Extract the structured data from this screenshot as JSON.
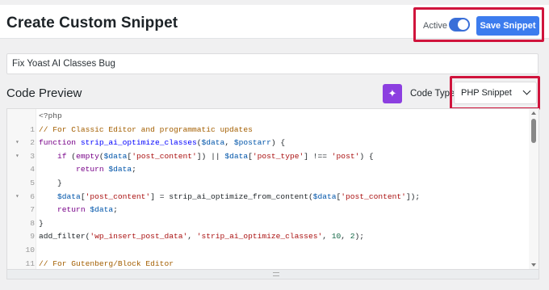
{
  "header": {
    "title": "Create Custom Snippet",
    "active_label": "Active",
    "active_on": true,
    "save_label": "Save Snippet"
  },
  "snippet": {
    "title_value": "Fix Yoast AI Classes Bug"
  },
  "code_section": {
    "title": "Code Preview",
    "code_type_label": "Code Type",
    "code_type_value": "PHP Snippet"
  },
  "colors": {
    "accent": "#3c7cee",
    "ai_button": "#8c3fe0",
    "highlight": "#d0143c"
  },
  "code_lines": [
    {
      "num": "",
      "fold": false,
      "tokens": [
        {
          "t": "<?php",
          "c": "meta"
        }
      ]
    },
    {
      "num": "1",
      "fold": false,
      "tokens": [
        {
          "t": "// For Classic Editor and programmatic updates",
          "c": "comment"
        }
      ]
    },
    {
      "num": "2",
      "fold": true,
      "tokens": [
        {
          "t": "function ",
          "c": "keyword"
        },
        {
          "t": "strip_ai_optimize_classes",
          "c": "def"
        },
        {
          "t": "(",
          "c": "plain"
        },
        {
          "t": "$data",
          "c": "var"
        },
        {
          "t": ", ",
          "c": "plain"
        },
        {
          "t": "$postarr",
          "c": "var"
        },
        {
          "t": ") {",
          "c": "plain"
        }
      ]
    },
    {
      "num": "3",
      "fold": true,
      "tokens": [
        {
          "t": "    ",
          "c": "plain"
        },
        {
          "t": "if",
          "c": "keyword"
        },
        {
          "t": " (",
          "c": "plain"
        },
        {
          "t": "empty",
          "c": "keyword"
        },
        {
          "t": "(",
          "c": "plain"
        },
        {
          "t": "$data",
          "c": "var"
        },
        {
          "t": "[",
          "c": "plain"
        },
        {
          "t": "'post_content'",
          "c": "string"
        },
        {
          "t": "]) || ",
          "c": "plain"
        },
        {
          "t": "$data",
          "c": "var"
        },
        {
          "t": "[",
          "c": "plain"
        },
        {
          "t": "'post_type'",
          "c": "string"
        },
        {
          "t": "] !== ",
          "c": "plain"
        },
        {
          "t": "'post'",
          "c": "string"
        },
        {
          "t": ") {",
          "c": "plain"
        }
      ]
    },
    {
      "num": "4",
      "fold": false,
      "tokens": [
        {
          "t": "        ",
          "c": "plain"
        },
        {
          "t": "return",
          "c": "keyword"
        },
        {
          "t": " ",
          "c": "plain"
        },
        {
          "t": "$data",
          "c": "var"
        },
        {
          "t": ";",
          "c": "plain"
        }
      ]
    },
    {
      "num": "5",
      "fold": false,
      "tokens": [
        {
          "t": "    }",
          "c": "plain"
        }
      ]
    },
    {
      "num": "6",
      "fold": true,
      "tokens": [
        {
          "t": "    ",
          "c": "plain"
        },
        {
          "t": "$data",
          "c": "var"
        },
        {
          "t": "[",
          "c": "plain"
        },
        {
          "t": "'post_content'",
          "c": "string"
        },
        {
          "t": "] = strip_ai_optimize_from_content(",
          "c": "plain"
        },
        {
          "t": "$data",
          "c": "var"
        },
        {
          "t": "[",
          "c": "plain"
        },
        {
          "t": "'post_content'",
          "c": "string"
        },
        {
          "t": "]);",
          "c": "plain"
        }
      ]
    },
    {
      "num": "7",
      "fold": false,
      "tokens": [
        {
          "t": "    ",
          "c": "plain"
        },
        {
          "t": "return",
          "c": "keyword"
        },
        {
          "t": " ",
          "c": "plain"
        },
        {
          "t": "$data",
          "c": "var"
        },
        {
          "t": ";",
          "c": "plain"
        }
      ]
    },
    {
      "num": "8",
      "fold": false,
      "tokens": [
        {
          "t": "}",
          "c": "plain"
        }
      ]
    },
    {
      "num": "9",
      "fold": false,
      "tokens": [
        {
          "t": "add_filter(",
          "c": "plain"
        },
        {
          "t": "'wp_insert_post_data'",
          "c": "string"
        },
        {
          "t": ", ",
          "c": "plain"
        },
        {
          "t": "'strip_ai_optimize_classes'",
          "c": "string"
        },
        {
          "t": ", ",
          "c": "plain"
        },
        {
          "t": "10",
          "c": "number"
        },
        {
          "t": ", ",
          "c": "plain"
        },
        {
          "t": "2",
          "c": "number"
        },
        {
          "t": ");",
          "c": "plain"
        }
      ]
    },
    {
      "num": "10",
      "fold": false,
      "tokens": []
    },
    {
      "num": "11",
      "fold": false,
      "tokens": [
        {
          "t": "// For Gutenberg/Block Editor",
          "c": "comment"
        }
      ]
    }
  ]
}
